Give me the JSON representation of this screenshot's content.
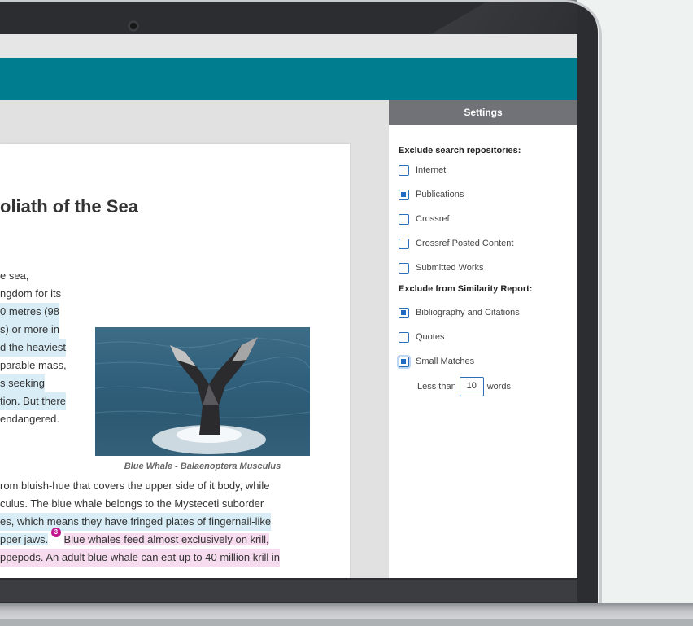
{
  "document": {
    "title_fragment": "oliath of the Sea",
    "left_column": [
      "e sea,",
      "ngdom for its",
      "0 metres (98",
      "s) or more in",
      "d the heaviest",
      "parable mass,",
      "s seeking",
      "tion. But there",
      "endangered."
    ],
    "image_caption": "Blue Whale - Balaenoptera Musculus",
    "paragraph": {
      "line1": "rom bluish-hue that covers the upper side of it body, while",
      "line2": "culus. The blue whale belongs to the Mysteceti suborder",
      "line3": "es, which means they have fringed plates of fingernail-like",
      "line4_a": "pper jaws.",
      "match_number": "3",
      "line4_b": "Blue whales feed almost exclusively on krill,",
      "line5": "ppepods. An adult blue whale can eat up to 40 million krill in"
    }
  },
  "settings": {
    "header": "Settings",
    "repositories_title": "Exclude search repositories:",
    "repositories": [
      {
        "label": "Internet",
        "checked": false
      },
      {
        "label": "Publications",
        "checked": true
      },
      {
        "label": "Crossref",
        "checked": false
      },
      {
        "label": "Crossref Posted Content",
        "checked": false
      },
      {
        "label": "Submitted Works",
        "checked": false
      }
    ],
    "similarity_title": "Exclude from Similarity Report:",
    "similarity": [
      {
        "label": "Bibliography and Citations",
        "checked": true
      },
      {
        "label": "Quotes",
        "checked": false
      },
      {
        "label": "Small Matches",
        "checked": true
      }
    ],
    "small_matches": {
      "prefix": "Less than",
      "value": "10",
      "suffix": "words"
    }
  },
  "colors": {
    "topbar": "#007e8f",
    "settings_header": "#707278",
    "checkbox": "#1f6cc4",
    "highlight_blue": "#d9edf6",
    "highlight_pink": "#f7dcef",
    "match_badge": "#c2178f"
  }
}
